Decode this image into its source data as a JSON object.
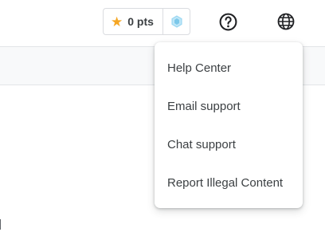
{
  "points_widget": {
    "label": "0 pts",
    "star_icon": "star-icon",
    "gem_icon": "gem-icon",
    "star_color": "#f5a623",
    "gem_color": "#8fd3f0"
  },
  "header_icons": {
    "help": "help-circle-icon",
    "language": "globe-icon"
  },
  "help_menu": {
    "items": [
      {
        "label": "Help Center"
      },
      {
        "label": "Email support"
      },
      {
        "label": "Chat support"
      },
      {
        "label": "Report Illegal Content"
      }
    ]
  },
  "colors": {
    "text": "#3c4043",
    "subbar_bg": "#f8f9fa",
    "divider": "#dadce0"
  }
}
